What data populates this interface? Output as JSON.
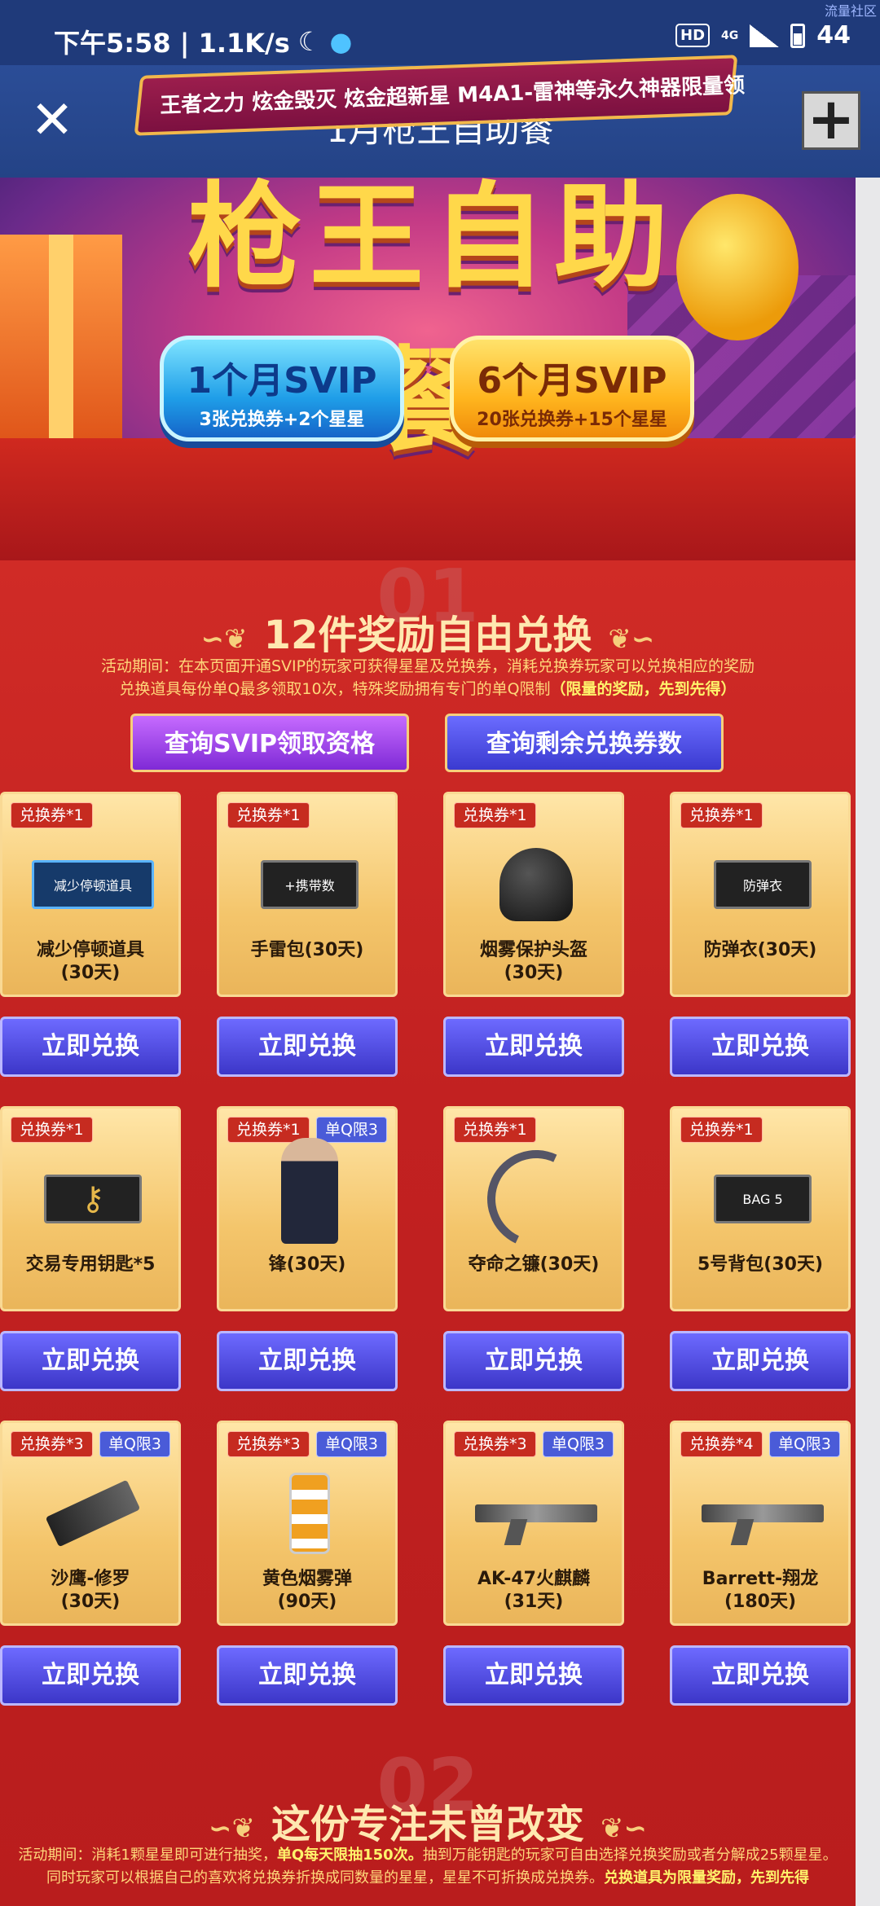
{
  "status_bar": {
    "time": "下午5:58 | 1.1K/s",
    "moon_icon": "moon-icon",
    "qq_icon": "qq-penguin-icon",
    "hd": "HD",
    "network": "4G",
    "battery": "44",
    "watermark": "流量社区"
  },
  "title_bar": {
    "title": "1月枪王自助餐",
    "close_icon": "close-icon",
    "add_icon": "plus-icon"
  },
  "banner": {
    "big_title": "枪王自助餐",
    "slogan": "王者之力  炫金毁灭  炫金超新星  M4A1-雷神等永久神器限量领",
    "svip_1": {
      "main": "1个月SVIP",
      "sub": "3张兑换券+2个星星"
    },
    "svip_6": {
      "main": "6个月SVIP",
      "sub": "20张兑换券+15个星星"
    }
  },
  "section1": {
    "number": "01",
    "title": "12件奖励自由兑换",
    "desc_line1": "活动期间：在本页面开通SVIP的玩家可获得星星及兑换券，消耗兑换券玩家可以兑换相应的奖励",
    "desc_line2_a": "兑换道具每份单Q最多领取10次，特殊奖励拥有专门的单Q限制",
    "desc_line2_b": "（限量的奖励，先到先得）",
    "query_svip": "查询SVIP领取资格",
    "query_coupon": "查询剩余兑换券数",
    "redeem_label": "立即兑换",
    "items": [
      {
        "coupon": "兑换券*1",
        "limit": "",
        "name_1": "减少停顿道具",
        "name_2": "(30天)",
        "img_text": "减少停顿道具"
      },
      {
        "coupon": "兑换券*1",
        "limit": "",
        "name_1": "手雷包(30天)",
        "name_2": "",
        "img_text": "+携带数"
      },
      {
        "coupon": "兑换券*1",
        "limit": "",
        "name_1": "烟雾保护头盔",
        "name_2": "(30天)",
        "img_text": ""
      },
      {
        "coupon": "兑换券*1",
        "limit": "",
        "name_1": "防弹衣(30天)",
        "name_2": "",
        "img_text": "防弹衣"
      },
      {
        "coupon": "兑换券*1",
        "limit": "",
        "name_1": "交易专用钥匙*5",
        "name_2": "",
        "img_text": ""
      },
      {
        "coupon": "兑换券*1",
        "limit": "单Q限3",
        "name_1": "锋(30天)",
        "name_2": "",
        "img_text": ""
      },
      {
        "coupon": "兑换券*1",
        "limit": "",
        "name_1": "夺命之镰(30天)",
        "name_2": "",
        "img_text": ""
      },
      {
        "coupon": "兑换券*1",
        "limit": "",
        "name_1": "5号背包(30天)",
        "name_2": "",
        "img_text": "BAG 5"
      },
      {
        "coupon": "兑换券*3",
        "limit": "单Q限3",
        "name_1": "沙鹰-修罗",
        "name_2": "(30天)",
        "img_text": ""
      },
      {
        "coupon": "兑换券*3",
        "limit": "单Q限3",
        "name_1": "黄色烟雾弹",
        "name_2": "(90天)",
        "img_text": ""
      },
      {
        "coupon": "兑换券*3",
        "limit": "单Q限3",
        "name_1": "AK-47火麒麟",
        "name_2": "(31天)",
        "img_text": ""
      },
      {
        "coupon": "兑换券*4",
        "limit": "单Q限3",
        "name_1": "Barrett-翔龙",
        "name_2": "(180天)",
        "img_text": ""
      }
    ]
  },
  "section2": {
    "number": "02",
    "title": "这份专注未曾改变",
    "desc_line1_a": "活动期间：消耗1颗星星即可进行抽奖，",
    "desc_line1_b": "单Q每天限抽150次。",
    "desc_line1_c": "抽到万能钥匙的玩家可自由选择兑换奖励或者分解成25颗星星。",
    "desc_line2_a": "同时玩家可以根据自己的喜欢将兑换券折换成同数量的星星，星星不可折换成兑换券。",
    "desc_line2_b": "兑换道具为限量奖励，先到先得"
  }
}
